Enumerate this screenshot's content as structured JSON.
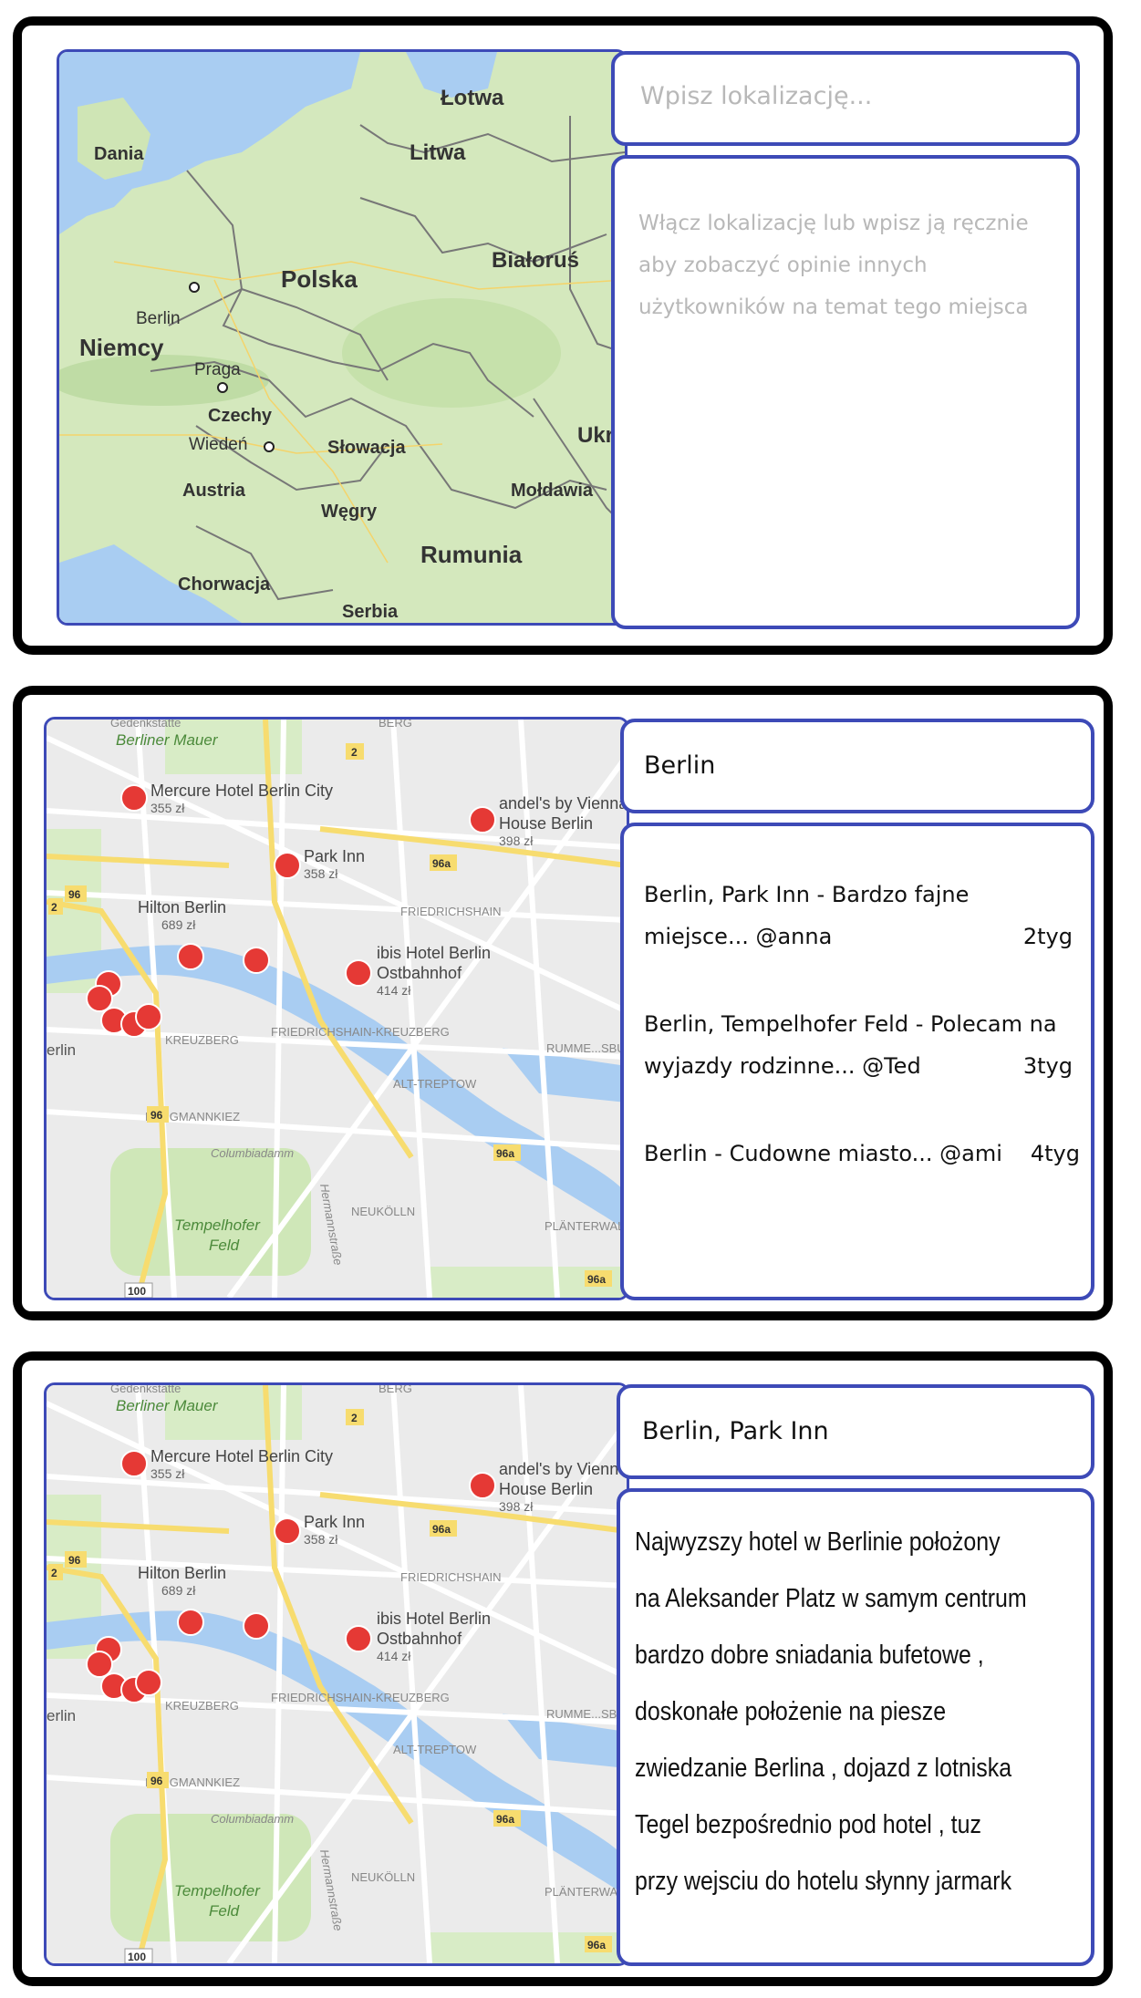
{
  "panel1": {
    "search": {
      "placeholder": "Wpisz lokalizację..."
    },
    "info_lines": [
      "Włącz lokalizację lub wpisz ją ręcznie",
      "aby zobaczyć opinie innych",
      "użytkowników na temat tego miejsca"
    ],
    "map": {
      "countries": {
        "lotwa": "Łotwa",
        "dania": "Dania",
        "litwa": "Litwa",
        "polska": "Polska",
        "bialorus": "Białoruś",
        "niemcy": "Niemcy",
        "czechy": "Czechy",
        "slowacja": "Słowacja",
        "ukraina": "Ukra",
        "austria": "Austria",
        "wegry": "Węgry",
        "moldawia": "Mołdawia",
        "rumunia": "Rumunia",
        "chorwacja": "Chorwacja",
        "serbia": "Serbia"
      },
      "cities": {
        "berlin": "Berlin",
        "praga": "Praga",
        "wieden": "Wiedeń"
      }
    }
  },
  "city_map": {
    "districts": {
      "mauer1": "Gedenkstätte",
      "mauer2": "Berliner Mauer",
      "friedrichshain": "FRIEDRICHSHAIN",
      "fkreuzberg": "FRIEDRICHSHAIN-KREUZBERG",
      "kreuzberg": "KREUZBERG",
      "rummels": "RUMME...SBU",
      "alttreptow": "ALT-TREPTOW",
      "bergmann": "BERGMANNKIEZ",
      "neukolln": "NEUKÖLLN",
      "plaenter": "PLÄNTERWALD",
      "berg": "BERG",
      "columbiadamm": "Columbiadamm",
      "hermann": "Hermannstraße",
      "tempelhofer1": "Tempelhofer",
      "tempelhofer2": "Feld",
      "erlin": "erlin"
    },
    "hotels": [
      {
        "name": "Mercure Hotel Berlin City",
        "price": "355 zł"
      },
      {
        "name": "andel's by Vienna",
        "name2": "House Berlin",
        "price": "398 zł"
      },
      {
        "name": "Park Inn",
        "price": "358 zł"
      },
      {
        "name": "Hilton Berlin",
        "price": "689 zł"
      },
      {
        "name": "ibis Hotel Berlin",
        "name2": "Ostbahnhof",
        "price": "414 zł"
      }
    ],
    "roads": {
      "r2": "2",
      "r96a1": "96a",
      "r96": "96",
      "r2b": "2",
      "r96b": "96",
      "r96a2": "96a",
      "r96a3": "96a",
      "r100": "100"
    }
  },
  "panel2": {
    "location": "Berlin",
    "reviews": [
      {
        "line1": "Berlin, Park Inn - Bardzo fajne",
        "line2": "miejsce... @anna",
        "time": "2tyg"
      },
      {
        "line1": "Berlin, Tempelhofer Feld - Polecam na",
        "line2": "wyjazdy rodzinne... @Ted",
        "time": "3tyg"
      },
      {
        "line1": "Berlin - Cudowne miasto... @ami",
        "line2": "",
        "time": "4tyg"
      }
    ]
  },
  "panel3": {
    "location": "Berlin, Park Inn",
    "description_lines": [
      "Najwyzszy hotel w Berlinie położony",
      "na Aleksander Platz w samym centrum",
      "bardzo dobre sniadania bufetowe ,",
      "doskonałe położenie na piesze",
      "zwiedzanie Berlina , dojazd z lotniska",
      "Tegel bezpośrednio pod hotel , tuz",
      "przy wejsciu do hotelu słynny jarmark"
    ]
  },
  "colors": {
    "border": "#3d4ab7",
    "frame": "#000000",
    "placeholder": "#b8b8b8",
    "land": "#cfe5b5",
    "water": "#a9cdf2",
    "hotel_pin": "#e53935"
  }
}
